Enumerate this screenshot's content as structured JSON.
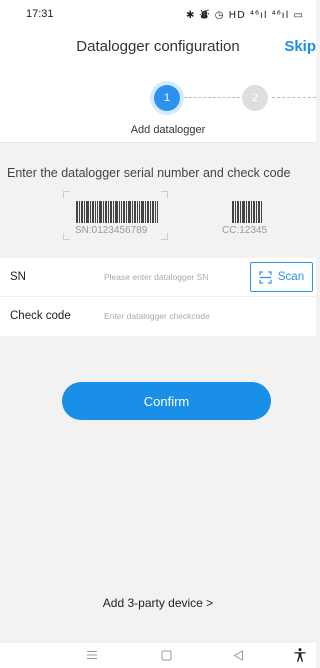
{
  "status_bar": {
    "time": "17:31",
    "icons": "✱ ⛇ ◷ HD ⁴⁶ıl ⁴⁶ıl ▭"
  },
  "header": {
    "title": "Datalogger configuration",
    "skip_label": "Skip"
  },
  "stepper": {
    "steps": [
      {
        "number": "1",
        "active": true
      },
      {
        "number": "2",
        "active": false
      }
    ],
    "current_label": "Add datalogger"
  },
  "instruction": {
    "text": "Enter the datalogger serial number and check code",
    "sn_example": "SN:0123456789",
    "cc_example": "CC:12345"
  },
  "form": {
    "sn_label": "SN",
    "sn_placeholder": "Please enter datalogger SN",
    "sn_value": "",
    "scan_label": "Scan",
    "check_code_label": "Check code",
    "check_code_placeholder": "Enter datalogger checkcode",
    "check_code_value": ""
  },
  "confirm_label": "Confirm",
  "third_party_label": "Add 3-party device  >",
  "colors": {
    "accent": "#1a8fe8",
    "step_active": "#2b93ee",
    "step_inactive": "#dedede",
    "background": "#f2f2f2"
  },
  "icons": {
    "scan": "scan-frame-icon",
    "nav_menu": "menu-icon",
    "nav_home": "home-square-icon",
    "nav_back": "back-triangle-icon",
    "nav_accessibility": "accessibility-icon"
  }
}
